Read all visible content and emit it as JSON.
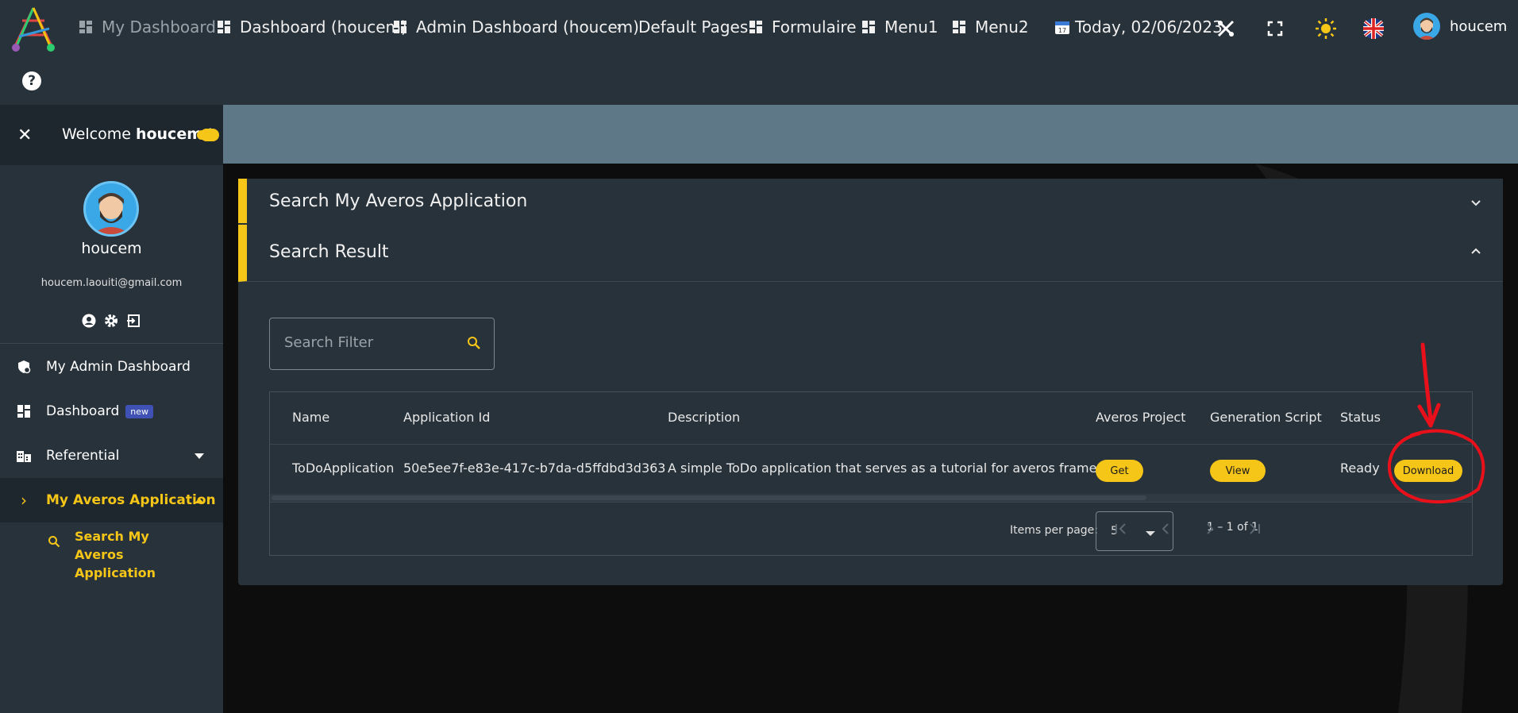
{
  "topbar": {
    "nav": [
      {
        "label": "My Dashboard",
        "icon": "dashboard-icon"
      },
      {
        "label": "Dashboard (houcem)",
        "icon": "dashboard-icon"
      },
      {
        "label": "Admin Dashboard (houcem)",
        "icon": "dashboard-icon"
      },
      {
        "label": "Default Pages",
        "icon": "chevron-right-icon"
      },
      {
        "label": "Formulaire",
        "icon": "dashboard-icon"
      },
      {
        "label": "Menu1",
        "icon": "dashboard-icon"
      },
      {
        "label": "Menu2",
        "icon": "dashboard-icon"
      }
    ],
    "date": "Today, 02/06/2023",
    "user": "houcem",
    "help": "?"
  },
  "sidebar": {
    "welcome_prefix": "Welcome ",
    "welcome_name": "houcem",
    "welcome_suffix": " !",
    "username": "houcem",
    "email": "houcem.laouiti@gmail.com",
    "menu": [
      {
        "label": "My Admin Dashboard",
        "icon": "admin-dashboard-icon"
      },
      {
        "label": "Dashboard",
        "icon": "dashboard-icon",
        "badge": "new"
      },
      {
        "label": "Referential",
        "icon": "referential-icon"
      },
      {
        "label": "My Averos Application",
        "icon": "chevron-right-icon"
      }
    ],
    "submenu": {
      "label": "Search My Averos Application",
      "icon": "search-icon"
    }
  },
  "main": {
    "search_panel_title": "Search My Averos Application",
    "result_panel_title": "Search Result",
    "search_placeholder": "Search Filter",
    "table": {
      "columns": [
        "Name",
        "Application Id",
        "Description",
        "Averos Project",
        "Generation Script",
        "Status"
      ],
      "rows": [
        {
          "name": "ToDoApplication",
          "app_id": "50e5ee7f-e83e-417c-b7da-d5ffdbd3d363",
          "description": "A simple ToDo application that serves as a tutorial for averos framework",
          "project_button": "Get",
          "script_button": "View",
          "status": "Ready",
          "download_button": "Download"
        }
      ]
    },
    "paginator": {
      "items_per_page_label": "Items per page:",
      "items_per_page": "5",
      "range": "1 – 1 of 1"
    }
  },
  "colors": {
    "accent": "#f5c518",
    "panel": "#28323a",
    "banner": "#5f7888",
    "annotation": "#e8101a"
  }
}
